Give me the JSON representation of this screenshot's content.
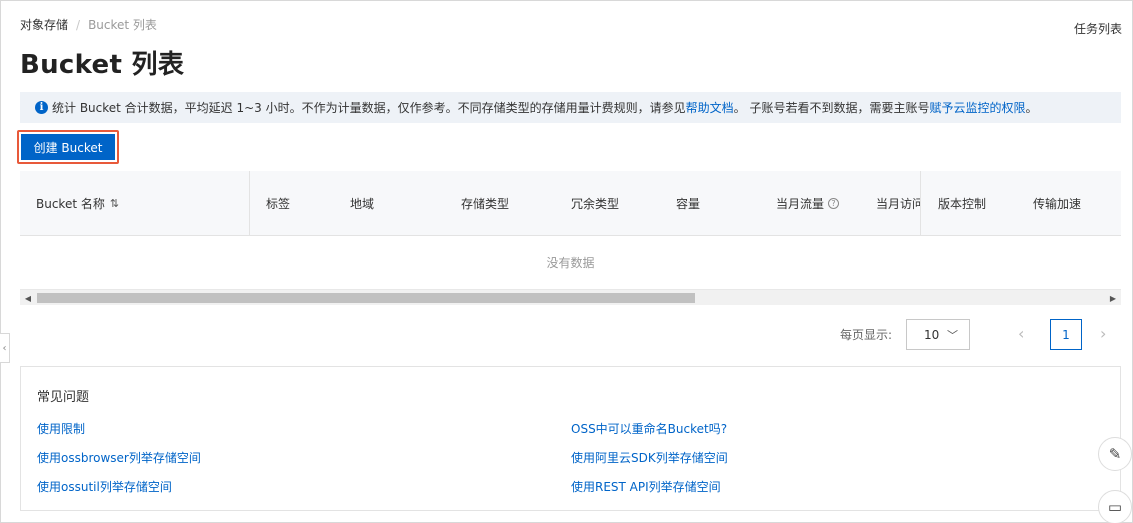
{
  "breadcrumb": {
    "root": "对象存储",
    "current": "Bucket 列表"
  },
  "header": {
    "task_list": "任务列表",
    "title": "Bucket 列表"
  },
  "notice": {
    "text_1": "统计 Bucket 合计数据，平均延迟 1~3 小时。不作为计量数据，仅作参考。不同存储类型的存储用量计费规则，请参见",
    "link_1": "帮助文档",
    "text_2": "。 子账号若看不到数据，需要主账号",
    "link_2": "赋予云监控的权限",
    "text_3": "。"
  },
  "toolbar": {
    "create_label": "创建 Bucket"
  },
  "table": {
    "columns": [
      "Bucket 名称",
      "标签",
      "地域",
      "存储类型",
      "冗余类型",
      "容量",
      "当月流量",
      "当月访问",
      "版本控制",
      "传输加速"
    ],
    "empty_text": "没有数据"
  },
  "pagination": {
    "page_size_label": "每页显示:",
    "page_size": "10",
    "current_page": "1"
  },
  "faq": {
    "title": "常见问题",
    "links_left": [
      "使用限制",
      "使用ossbrowser列举存储空间",
      "使用ossutil列举存储空间"
    ],
    "links_right": [
      "OSS中可以重命名Bucket吗?",
      "使用阿里云SDK列举存储空间",
      "使用REST API列举存储空间"
    ]
  },
  "colors": {
    "accent": "#0064c8",
    "highlight_border": "#e8593a",
    "notice_bg": "#eef2f7"
  }
}
